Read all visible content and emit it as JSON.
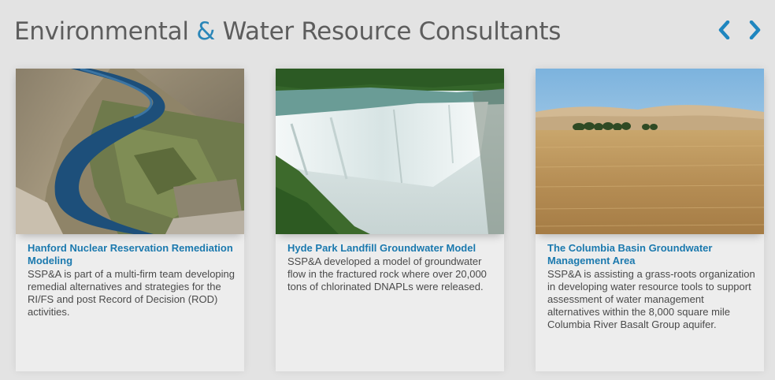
{
  "header": {
    "title_part1": "Environmental ",
    "title_amp": "&",
    "title_part2": " Water Resource Consultants",
    "accent_color": "#2a86b8"
  },
  "nav": {
    "prev_icon": "chevron-left-icon",
    "next_icon": "chevron-right-icon",
    "color": "#1f86bf"
  },
  "cards": [
    {
      "image": "aerial river valley with orchards",
      "title": "Hanford Nuclear Reservation Remediation Modeling",
      "description": "SSP&A is part of a multi-firm team developing remedial alternatives and strategies for the RI/FS and post Record of Decision (ROD) activities."
    },
    {
      "image": "waterfall over cliff",
      "title": "Hyde Park Landfill Groundwater Model",
      "description": "SSP&A  developed a model of groundwater flow in the fractured rock where over 20,000 tons of chlorinated DNAPLs were released."
    },
    {
      "image": "wheat field with hills",
      "title": "The Columbia Basin Groundwater Management Area",
      "description": "SSP&A is assisting a grass-roots organization in developing water resource tools to support assessment of water management alternatives within the 8,000 square mile Columbia River Basalt Group aquifer."
    }
  ]
}
